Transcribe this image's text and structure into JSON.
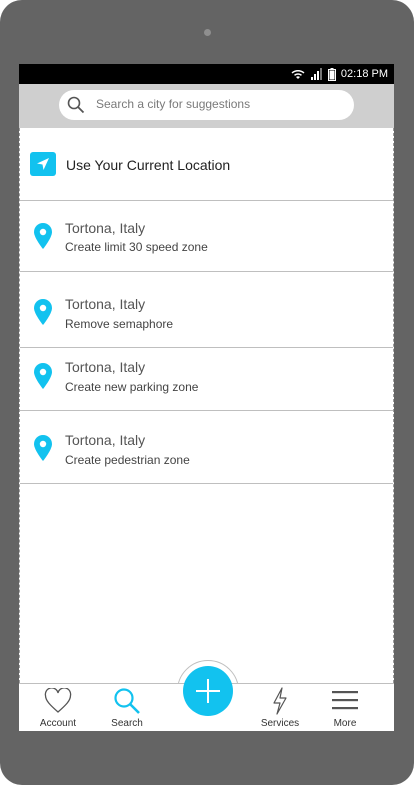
{
  "status_bar": {
    "time": "02:18 PM",
    "icons": [
      "wifi-icon",
      "signal-icon",
      "battery-icon"
    ]
  },
  "search": {
    "placeholder": "Search a city for suggestions",
    "icon": "search-icon"
  },
  "current_location": {
    "label": "Use Your Current Location",
    "icon": "navigation-arrow-icon"
  },
  "suggestions": [
    {
      "city": "Tortona, Italy",
      "action": "Create limit 30 speed zone"
    },
    {
      "city": "Tortona, Italy",
      "action": "Remove semaphore"
    },
    {
      "city": "Tortona, Italy",
      "action": "Create new parking zone"
    },
    {
      "city": "Tortona, Italy",
      "action": "Create pedestrian zone"
    }
  ],
  "tabbar": {
    "account": "Account",
    "search": "Search",
    "services": "Services",
    "more": "More",
    "add_icon": "plus-icon"
  },
  "colors": {
    "accent": "#12c2ef",
    "device": "#646464",
    "search_bar_bg": "#cfcfcf"
  }
}
